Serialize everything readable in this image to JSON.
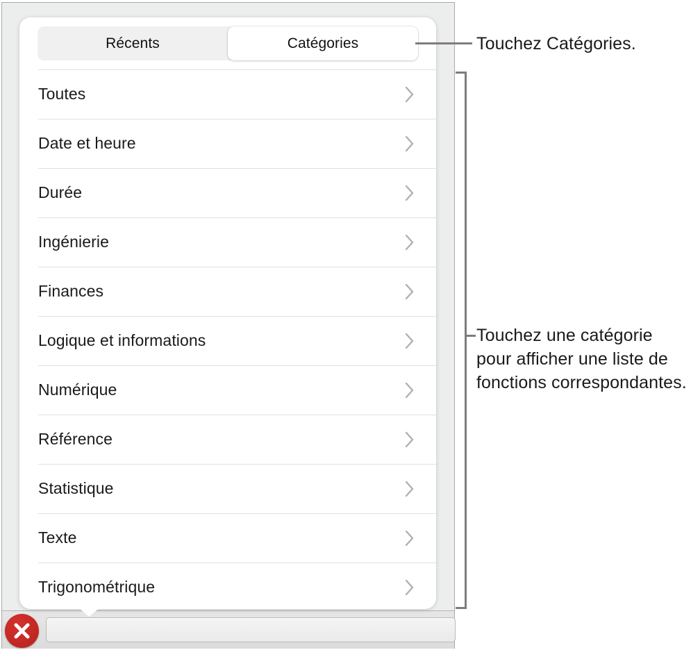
{
  "window": {
    "background_color": "#eceded",
    "border_color": "#a8a8a8"
  },
  "popover": {
    "segmented_control": {
      "name": "function-browser-tabs",
      "segments": [
        {
          "label": "Récents",
          "selected": false
        },
        {
          "label": "Catégories",
          "selected": true
        }
      ]
    },
    "category_list": {
      "items": [
        {
          "label": "Toutes",
          "accessory": "chevron-right-icon"
        },
        {
          "label": "Date et heure",
          "accessory": "chevron-right-icon"
        },
        {
          "label": "Durée",
          "accessory": "chevron-right-icon"
        },
        {
          "label": "Ingénierie",
          "accessory": "chevron-right-icon"
        },
        {
          "label": "Finances",
          "accessory": "chevron-right-icon"
        },
        {
          "label": "Logique et informations",
          "accessory": "chevron-right-icon"
        },
        {
          "label": "Numérique",
          "accessory": "chevron-right-icon"
        },
        {
          "label": "Référence",
          "accessory": "chevron-right-icon"
        },
        {
          "label": "Statistique",
          "accessory": "chevron-right-icon"
        },
        {
          "label": "Texte",
          "accessory": "chevron-right-icon"
        },
        {
          "label": "Trigonométrique",
          "accessory": "chevron-right-icon"
        }
      ]
    }
  },
  "bottom_bar": {
    "close_button": {
      "icon": "close-x-icon",
      "color": "#c42823"
    },
    "formula_field": {
      "value": "",
      "placeholder": ""
    }
  },
  "annotations": {
    "callout_1": "Touchez Catégories.",
    "callout_2": "Touchez une catégorie pour afficher une liste de fonctions correspondantes.",
    "line_color": "#7d7d7d"
  }
}
